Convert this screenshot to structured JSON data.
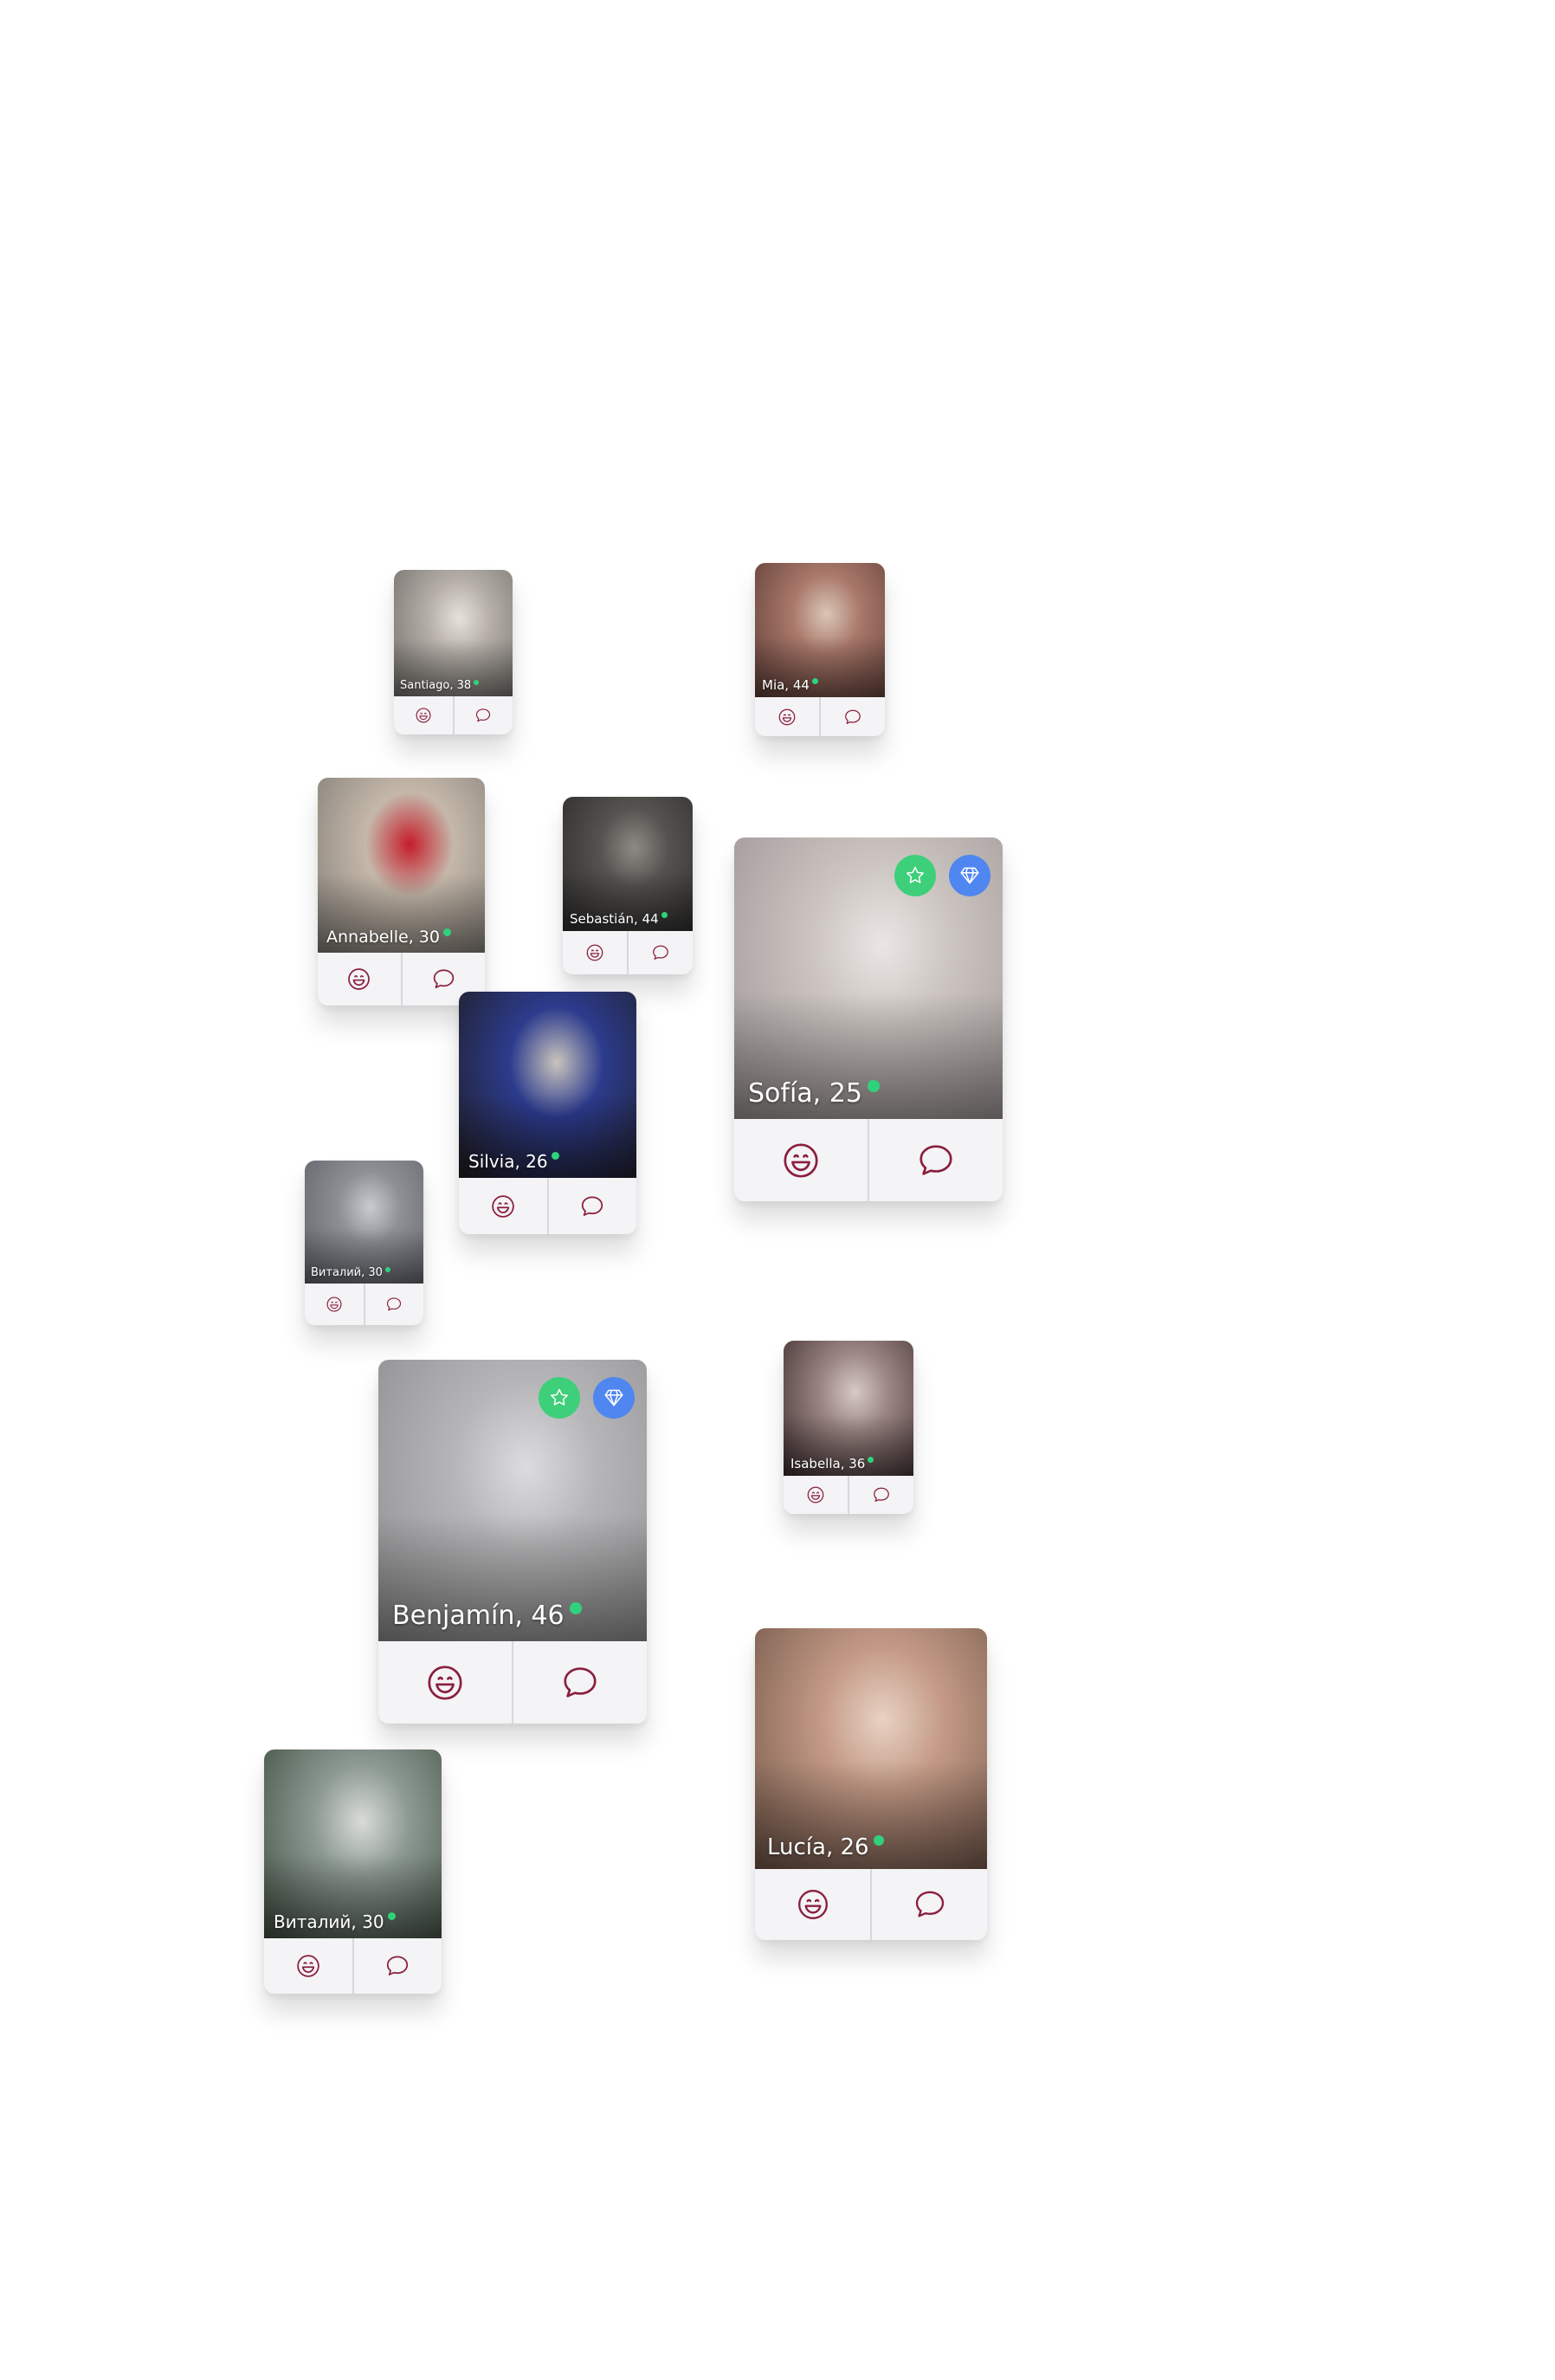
{
  "accent_color": "#8a1f3d",
  "online_color": "#2fd27b",
  "badge_colors": {
    "favorite": "#3ecf7a",
    "premium": "#4f86f0"
  },
  "profiles": [
    {
      "label": "Santiago, 38",
      "actions": [
        "smile-icon",
        "chat-bubble-icon"
      ]
    },
    {
      "label": "Mia, 44",
      "actions": [
        "smile-icon",
        "chat-bubble-icon"
      ]
    },
    {
      "label": "Annabelle, 30",
      "actions": [
        "smile-icon",
        "chat-bubble-icon"
      ]
    },
    {
      "label": "Sebastián, 44",
      "actions": [
        "smile-icon",
        "chat-bubble-icon"
      ]
    },
    {
      "label": "Sofía, 25",
      "actions": [
        "smile-icon",
        "chat-bubble-icon"
      ],
      "badges": [
        "star-icon",
        "diamond-icon"
      ]
    },
    {
      "label": "Silvia, 26",
      "actions": [
        "smile-icon",
        "chat-bubble-icon"
      ]
    },
    {
      "label": "Виталий, 30",
      "actions": [
        "smile-icon",
        "chat-bubble-icon"
      ]
    },
    {
      "label": "Benjamín, 46",
      "actions": [
        "smile-icon",
        "chat-bubble-icon"
      ],
      "badges": [
        "star-icon",
        "diamond-icon"
      ]
    },
    {
      "label": "Isabella, 36",
      "actions": [
        "smile-icon",
        "chat-bubble-icon"
      ]
    },
    {
      "label": "Lucía, 26",
      "actions": [
        "smile-icon",
        "chat-bubble-icon"
      ]
    },
    {
      "label": "Виталий, 30",
      "actions": [
        "smile-icon",
        "chat-bubble-icon"
      ]
    }
  ]
}
